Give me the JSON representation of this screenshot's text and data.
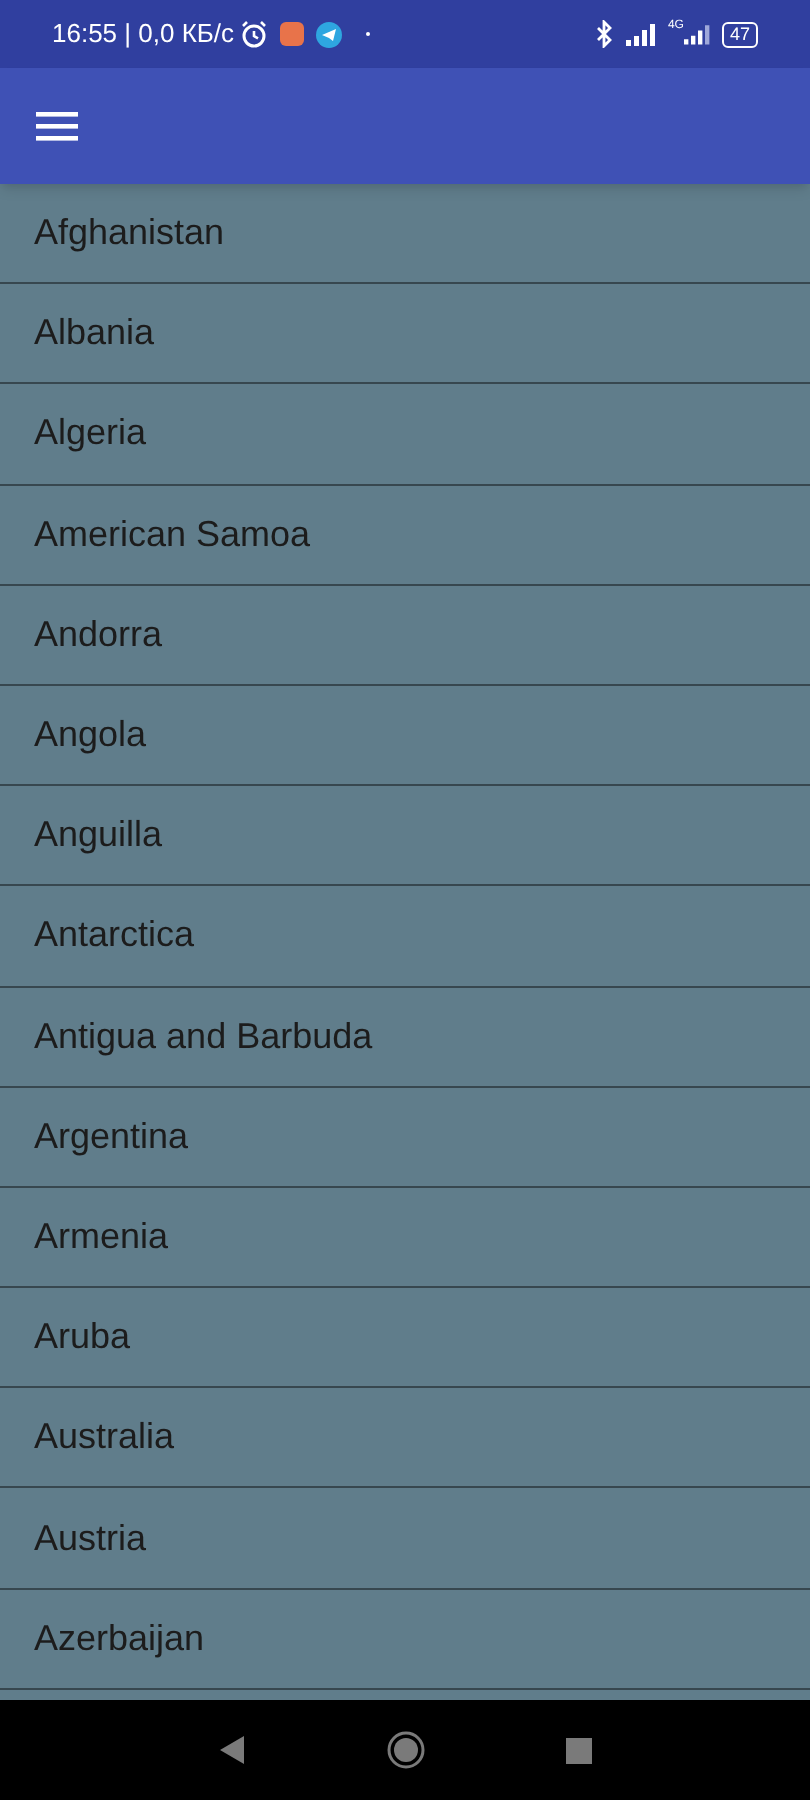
{
  "status_bar": {
    "time": "16:55 | 0,0 КБ/с",
    "network": "4G",
    "battery": "47"
  },
  "countries": [
    {
      "name": "Afghanistan"
    },
    {
      "name": "Albania"
    },
    {
      "name": "Algeria"
    },
    {
      "name": "American Samoa"
    },
    {
      "name": "Andorra"
    },
    {
      "name": "Angola"
    },
    {
      "name": "Anguilla"
    },
    {
      "name": "Antarctica"
    },
    {
      "name": "Antigua and Barbuda"
    },
    {
      "name": "Argentina"
    },
    {
      "name": "Armenia"
    },
    {
      "name": "Aruba"
    },
    {
      "name": "Australia"
    },
    {
      "name": "Austria"
    },
    {
      "name": "Azerbaijan"
    }
  ]
}
